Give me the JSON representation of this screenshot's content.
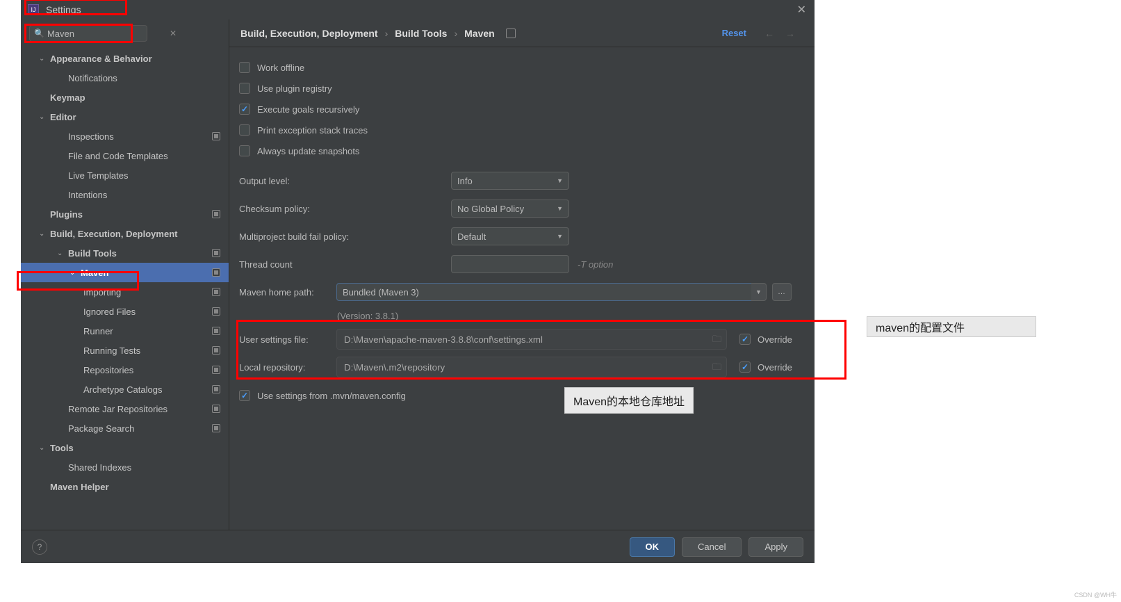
{
  "window": {
    "title": "Settings"
  },
  "search": {
    "value": "Maven"
  },
  "tree": {
    "appearance": "Appearance & Behavior",
    "notifications": "Notifications",
    "keymap": "Keymap",
    "editor": "Editor",
    "inspections": "Inspections",
    "file_code_templates": "File and Code Templates",
    "live_templates": "Live Templates",
    "intentions": "Intentions",
    "plugins": "Plugins",
    "bed": "Build, Execution, Deployment",
    "build_tools": "Build Tools",
    "maven": "Maven",
    "importing": "Importing",
    "ignored_files": "Ignored Files",
    "runner": "Runner",
    "running_tests": "Running Tests",
    "repositories": "Repositories",
    "archetype_catalogs": "Archetype Catalogs",
    "remote_jar": "Remote Jar Repositories",
    "package_search": "Package Search",
    "tools": "Tools",
    "shared_indexes": "Shared Indexes",
    "maven_helper": "Maven Helper"
  },
  "breadcrumb": {
    "a": "Build, Execution, Deployment",
    "b": "Build Tools",
    "c": "Maven"
  },
  "actions": {
    "reset": "Reset"
  },
  "checks": {
    "work_offline": "Work offline",
    "use_plugin_registry": "Use plugin registry",
    "execute_goals": "Execute goals recursively",
    "print_exception": "Print exception stack traces",
    "always_update": "Always update snapshots",
    "use_mvn_config": "Use settings from .mvn/maven.config"
  },
  "form": {
    "output_level_label": "Output level:",
    "output_level_value": "Info",
    "checksum_label": "Checksum policy:",
    "checksum_value": "No Global Policy",
    "multiproject_label": "Multiproject build fail policy:",
    "multiproject_value": "Default",
    "thread_count_label": "Thread count",
    "thread_hint": "-T option",
    "home_path_label": "Maven home path:",
    "home_path_value": "Bundled (Maven 3)",
    "version": "(Version: 3.8.1)",
    "user_settings_label": "User settings file:",
    "user_settings_value": "D:\\Maven\\apache-maven-3.8.8\\conf\\settings.xml",
    "local_repo_label": "Local repository:",
    "local_repo_value": "D:\\Maven\\.m2\\repository",
    "override": "Override"
  },
  "buttons": {
    "ok": "OK",
    "cancel": "Cancel",
    "apply": "Apply"
  },
  "callouts": {
    "maven_config": "maven的配置文件",
    "local_repo": "Maven的本地仓库地址"
  },
  "watermark": "CSDN @WH牛"
}
